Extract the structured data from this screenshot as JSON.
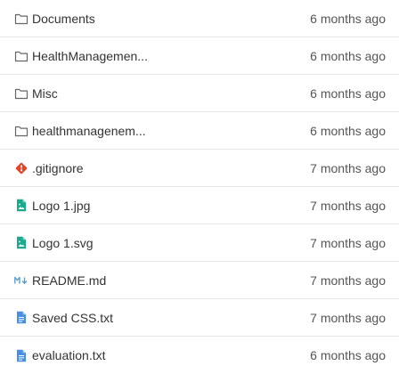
{
  "files": [
    {
      "name": "Documents",
      "date": "6 months ago",
      "icon": "folder-icon"
    },
    {
      "name": "HealthManagemen...",
      "date": "6 months ago",
      "icon": "folder-icon"
    },
    {
      "name": "Misc",
      "date": "6 months ago",
      "icon": "folder-icon"
    },
    {
      "name": "healthmanagenem...",
      "date": "6 months ago",
      "icon": "folder-icon"
    },
    {
      "name": ".gitignore",
      "date": "7 months ago",
      "icon": "git-icon"
    },
    {
      "name": "Logo 1.jpg",
      "date": "7 months ago",
      "icon": "image-file-icon"
    },
    {
      "name": "Logo 1.svg",
      "date": "7 months ago",
      "icon": "image-file-icon"
    },
    {
      "name": "README.md",
      "date": "7 months ago",
      "icon": "markdown-icon"
    },
    {
      "name": "Saved CSS.txt",
      "date": "7 months ago",
      "icon": "text-file-icon"
    },
    {
      "name": "evaluation.txt",
      "date": "6 months ago",
      "icon": "text-file-icon"
    }
  ],
  "colors": {
    "folder": "#666666",
    "git": "#e24329",
    "image": "#1aaa8e",
    "markdown": "#5a9fd4",
    "text_file": "#4a90e2"
  }
}
